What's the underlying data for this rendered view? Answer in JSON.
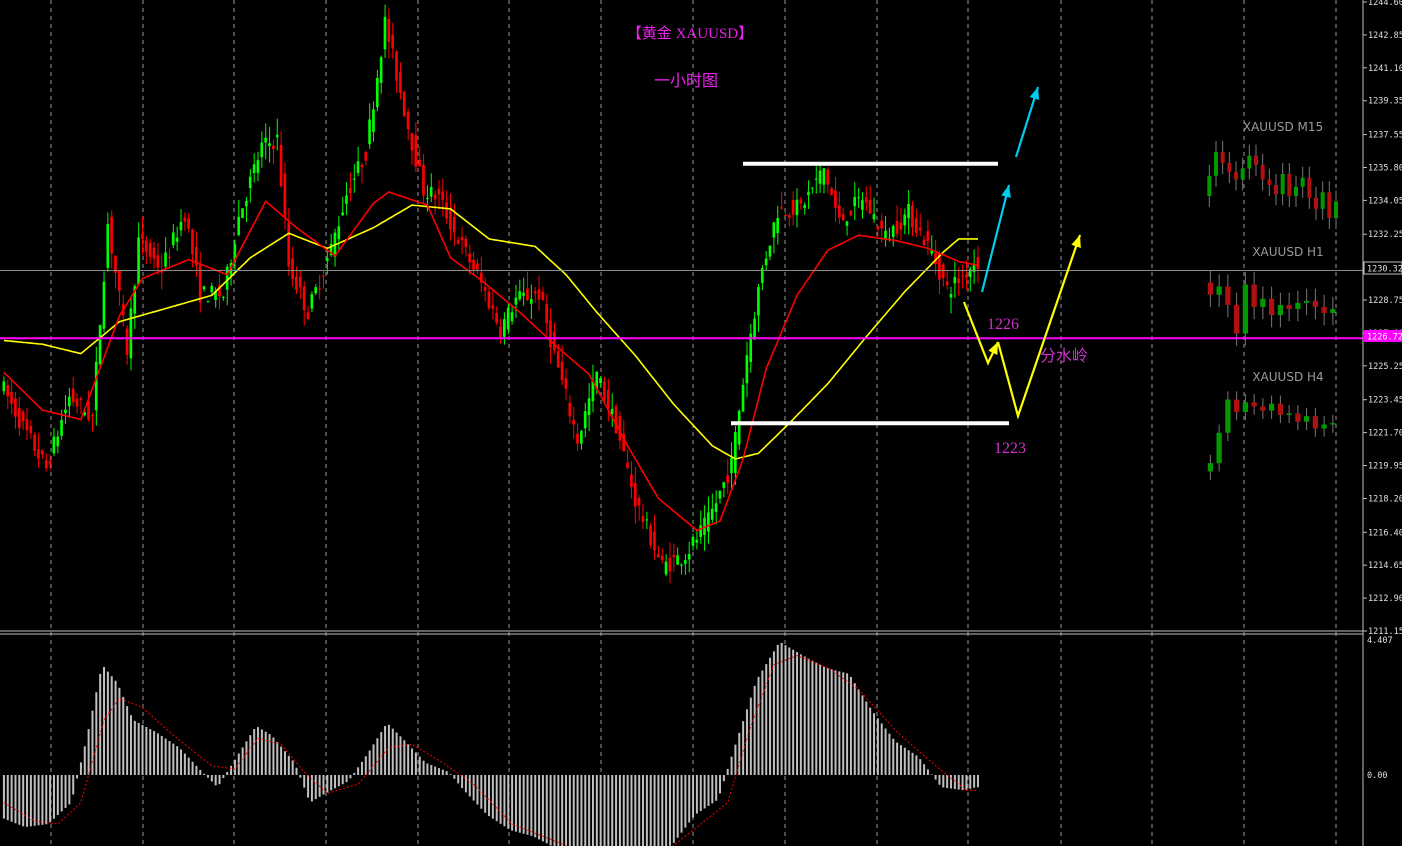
{
  "chart_data": {
    "type": "candlestick",
    "title": "【黄金 XAUUSD】",
    "subtitle": "一小时图",
    "price_axis": {
      "min": 1211.15,
      "max": 1244.6,
      "ticks": [
        "1244.60",
        "1242.85",
        "1241.10",
        "1239.35",
        "1237.55",
        "1235.80",
        "1234.05",
        "1232.25",
        "1230.50",
        "1228.75",
        "1227.00",
        "1225.25",
        "1223.45",
        "1221.70",
        "1219.95",
        "1218.20",
        "1216.40",
        "1214.65",
        "1212.90",
        "1211.15"
      ],
      "current_price_label": "1230.32",
      "pivot_price_label": "1226.72",
      "current_price": 1230.32,
      "pivot_price": 1226.72
    },
    "annotations": {
      "level_1226": "1226",
      "level_1223": "1223",
      "pivot_label": "分水岭",
      "resistance_level": 1236.0,
      "support_level": 1222.2
    },
    "price_path": [
      [
        0,
        1224.4
      ],
      [
        6,
        1222.0
      ],
      [
        12,
        1219.8
      ],
      [
        18,
        1223.6
      ],
      [
        24,
        1222.5
      ],
      [
        28,
        1232.8
      ],
      [
        30,
        1230.2
      ],
      [
        33,
        1226.1
      ],
      [
        36,
        1231.9
      ],
      [
        42,
        1230.4
      ],
      [
        48,
        1233.4
      ],
      [
        52,
        1229.1
      ],
      [
        58,
        1229.0
      ],
      [
        62,
        1233.2
      ],
      [
        68,
        1236.9
      ],
      [
        72,
        1237.3
      ],
      [
        75,
        1230.6
      ],
      [
        80,
        1228.1
      ],
      [
        86,
        1231.5
      ],
      [
        90,
        1234.4
      ],
      [
        95,
        1236.6
      ],
      [
        100,
        1243.5
      ],
      [
        106,
        1238.0
      ],
      [
        110,
        1234.6
      ],
      [
        114,
        1234.2
      ],
      [
        118,
        1232.4
      ],
      [
        124,
        1230.1
      ],
      [
        130,
        1227.2
      ],
      [
        134,
        1228.8
      ],
      [
        140,
        1229.1
      ],
      [
        145,
        1225.1
      ],
      [
        150,
        1221.3
      ],
      [
        155,
        1224.8
      ],
      [
        160,
        1222.1
      ],
      [
        165,
        1218.1
      ],
      [
        172,
        1214.6
      ],
      [
        178,
        1215.2
      ],
      [
        184,
        1217.0
      ],
      [
        190,
        1220.0
      ],
      [
        194,
        1225.9
      ],
      [
        198,
        1230.4
      ],
      [
        202,
        1233.5
      ],
      [
        208,
        1233.7
      ],
      [
        214,
        1235.7
      ],
      [
        218,
        1232.9
      ],
      [
        224,
        1234.2
      ],
      [
        230,
        1232.1
      ],
      [
        236,
        1233.4
      ],
      [
        242,
        1231.3
      ],
      [
        246,
        1229.3
      ],
      [
        250,
        1230.0
      ],
      [
        253,
        1230.8
      ]
    ],
    "ma_fast": [
      [
        0,
        1224.9
      ],
      [
        10,
        1222.9
      ],
      [
        20,
        1222.4
      ],
      [
        26,
        1225.7
      ],
      [
        30,
        1227.9
      ],
      [
        36,
        1229.9
      ],
      [
        48,
        1230.9
      ],
      [
        58,
        1230.1
      ],
      [
        68,
        1234.0
      ],
      [
        76,
        1232.6
      ],
      [
        86,
        1231.1
      ],
      [
        96,
        1233.9
      ],
      [
        100,
        1234.5
      ],
      [
        110,
        1233.8
      ],
      [
        116,
        1231.0
      ],
      [
        124,
        1229.8
      ],
      [
        134,
        1228.1
      ],
      [
        144,
        1226.2
      ],
      [
        152,
        1224.8
      ],
      [
        162,
        1221.0
      ],
      [
        170,
        1218.2
      ],
      [
        180,
        1216.5
      ],
      [
        186,
        1217.0
      ],
      [
        192,
        1220.3
      ],
      [
        198,
        1225.1
      ],
      [
        206,
        1229.0
      ],
      [
        214,
        1231.4
      ],
      [
        222,
        1232.2
      ],
      [
        232,
        1231.9
      ],
      [
        240,
        1231.5
      ],
      [
        248,
        1230.8
      ],
      [
        253,
        1230.6
      ]
    ],
    "ma_slow": [
      [
        0,
        1226.6
      ],
      [
        10,
        1226.4
      ],
      [
        20,
        1225.9
      ],
      [
        30,
        1227.6
      ],
      [
        42,
        1228.3
      ],
      [
        54,
        1229.0
      ],
      [
        64,
        1231.0
      ],
      [
        74,
        1232.3
      ],
      [
        84,
        1231.5
      ],
      [
        96,
        1232.6
      ],
      [
        106,
        1233.8
      ],
      [
        116,
        1233.6
      ],
      [
        126,
        1232.0
      ],
      [
        138,
        1231.6
      ],
      [
        146,
        1230.1
      ],
      [
        154,
        1228.1
      ],
      [
        164,
        1225.8
      ],
      [
        174,
        1223.2
      ],
      [
        184,
        1221.0
      ],
      [
        190,
        1220.3
      ],
      [
        196,
        1220.6
      ],
      [
        204,
        1222.2
      ],
      [
        214,
        1224.3
      ],
      [
        224,
        1226.8
      ],
      [
        234,
        1229.2
      ],
      [
        244,
        1231.3
      ],
      [
        248,
        1232.0
      ],
      [
        253,
        1232.0
      ]
    ],
    "macd": {
      "zero_label": "0.00",
      "max_label": "4.407",
      "max": 4.407,
      "histogram": [
        [
          0,
          -1.4
        ],
        [
          6,
          -1.7
        ],
        [
          12,
          -1.6
        ],
        [
          18,
          -0.9
        ],
        [
          22,
          1.2
        ],
        [
          26,
          3.6
        ],
        [
          30,
          3.0
        ],
        [
          34,
          1.8
        ],
        [
          40,
          1.4
        ],
        [
          46,
          0.9
        ],
        [
          52,
          0.1
        ],
        [
          56,
          -0.4
        ],
        [
          60,
          0.4
        ],
        [
          66,
          1.6
        ],
        [
          70,
          1.3
        ],
        [
          76,
          0.4
        ],
        [
          80,
          -0.9
        ],
        [
          84,
          -0.6
        ],
        [
          90,
          -0.2
        ],
        [
          95,
          0.7
        ],
        [
          100,
          1.7
        ],
        [
          104,
          1.2
        ],
        [
          110,
          0.4
        ],
        [
          116,
          0.1
        ],
        [
          120,
          -0.5
        ],
        [
          126,
          -1.3
        ],
        [
          132,
          -1.8
        ],
        [
          138,
          -2.0
        ],
        [
          144,
          -2.4
        ],
        [
          150,
          -2.6
        ],
        [
          156,
          -2.4
        ],
        [
          162,
          -2.9
        ],
        [
          168,
          -2.4
        ],
        [
          174,
          -2.3
        ],
        [
          180,
          -1.3
        ],
        [
          186,
          -0.8
        ],
        [
          190,
          0.8
        ],
        [
          196,
          3.1
        ],
        [
          202,
          4.35
        ],
        [
          208,
          3.9
        ],
        [
          214,
          3.5
        ],
        [
          220,
          3.3
        ],
        [
          226,
          2.1
        ],
        [
          232,
          1.1
        ],
        [
          238,
          0.6
        ],
        [
          244,
          -0.4
        ],
        [
          250,
          -0.5
        ],
        [
          253,
          -0.4
        ]
      ],
      "signal": [
        [
          0,
          -0.9
        ],
        [
          8,
          -1.5
        ],
        [
          14,
          -1.6
        ],
        [
          20,
          -0.9
        ],
        [
          26,
          1.8
        ],
        [
          30,
          2.5
        ],
        [
          36,
          2.2
        ],
        [
          44,
          1.3
        ],
        [
          54,
          0.3
        ],
        [
          60,
          0.2
        ],
        [
          66,
          1.2
        ],
        [
          72,
          1.0
        ],
        [
          78,
          0.1
        ],
        [
          84,
          -0.6
        ],
        [
          92,
          -0.3
        ],
        [
          100,
          0.9
        ],
        [
          106,
          1.0
        ],
        [
          114,
          0.4
        ],
        [
          122,
          -0.3
        ],
        [
          132,
          -1.6
        ],
        [
          142,
          -2.1
        ],
        [
          152,
          -2.6
        ],
        [
          162,
          -2.7
        ],
        [
          172,
          -2.5
        ],
        [
          182,
          -1.5
        ],
        [
          188,
          -0.9
        ],
        [
          194,
          1.6
        ],
        [
          200,
          3.6
        ],
        [
          206,
          3.9
        ],
        [
          214,
          3.5
        ],
        [
          222,
          2.8
        ],
        [
          232,
          1.4
        ],
        [
          242,
          0.3
        ],
        [
          250,
          -0.5
        ],
        [
          253,
          -0.5
        ]
      ]
    },
    "mini_charts": [
      {
        "label": "XAUUSD M15",
        "path": [
          [
            0,
            1233.9
          ],
          [
            1,
            1235.0
          ],
          [
            2,
            1236.3
          ],
          [
            3,
            1235.7
          ],
          [
            4,
            1235.2
          ],
          [
            5,
            1234.8
          ],
          [
            6,
            1235.4
          ],
          [
            7,
            1236.1
          ],
          [
            8,
            1235.6
          ],
          [
            9,
            1234.8
          ],
          [
            10,
            1234.5
          ],
          [
            11,
            1234.0
          ],
          [
            12,
            1235.1
          ],
          [
            13,
            1233.9
          ],
          [
            14,
            1234.4
          ],
          [
            15,
            1234.9
          ],
          [
            16,
            1233.8
          ],
          [
            17,
            1233.2
          ],
          [
            18,
            1234.1
          ],
          [
            19,
            1232.7
          ],
          [
            20,
            1233.6
          ]
        ]
      },
      {
        "label": "XAUUSD H1",
        "path": [
          [
            0,
            1229.2
          ],
          [
            1,
            1228.6
          ],
          [
            2,
            1229.0
          ],
          [
            3,
            1228.1
          ],
          [
            4,
            1226.7
          ],
          [
            5,
            1229.1
          ],
          [
            6,
            1228.0
          ],
          [
            7,
            1228.4
          ],
          [
            8,
            1227.6
          ],
          [
            9,
            1228.1
          ],
          [
            10,
            1227.9
          ],
          [
            11,
            1228.2
          ],
          [
            12,
            1228.3
          ],
          [
            13,
            1228.0
          ],
          [
            14,
            1227.7
          ],
          [
            15,
            1227.9
          ]
        ]
      },
      {
        "label": "XAUUSD H4",
        "path": [
          [
            0,
            1218.8
          ],
          [
            1,
            1219.4
          ],
          [
            2,
            1221.6
          ],
          [
            3,
            1224.0
          ],
          [
            4,
            1223.1
          ],
          [
            5,
            1223.8
          ],
          [
            6,
            1223.5
          ],
          [
            7,
            1223.2
          ],
          [
            8,
            1223.7
          ],
          [
            9,
            1222.9
          ],
          [
            10,
            1223.0
          ],
          [
            11,
            1222.4
          ],
          [
            12,
            1222.8
          ],
          [
            13,
            1221.9
          ],
          [
            14,
            1222.2
          ],
          [
            15,
            1222.3
          ]
        ]
      }
    ],
    "colors": {
      "background": "#000000",
      "bull": "#00ff00",
      "bear": "#ff0000",
      "ma_fast": "#ff0000",
      "ma_slow": "#ffff00",
      "pivot_line": "#ff00ff",
      "level_lines": "#ffffff",
      "forecast_up": "#00ccee",
      "forecast_path": "#ffff00",
      "annotation_text": "#cc33cc",
      "grid": "#c8c8c8",
      "macd_hist": "#c0c0c0",
      "macd_signal": "#ff0000"
    }
  }
}
